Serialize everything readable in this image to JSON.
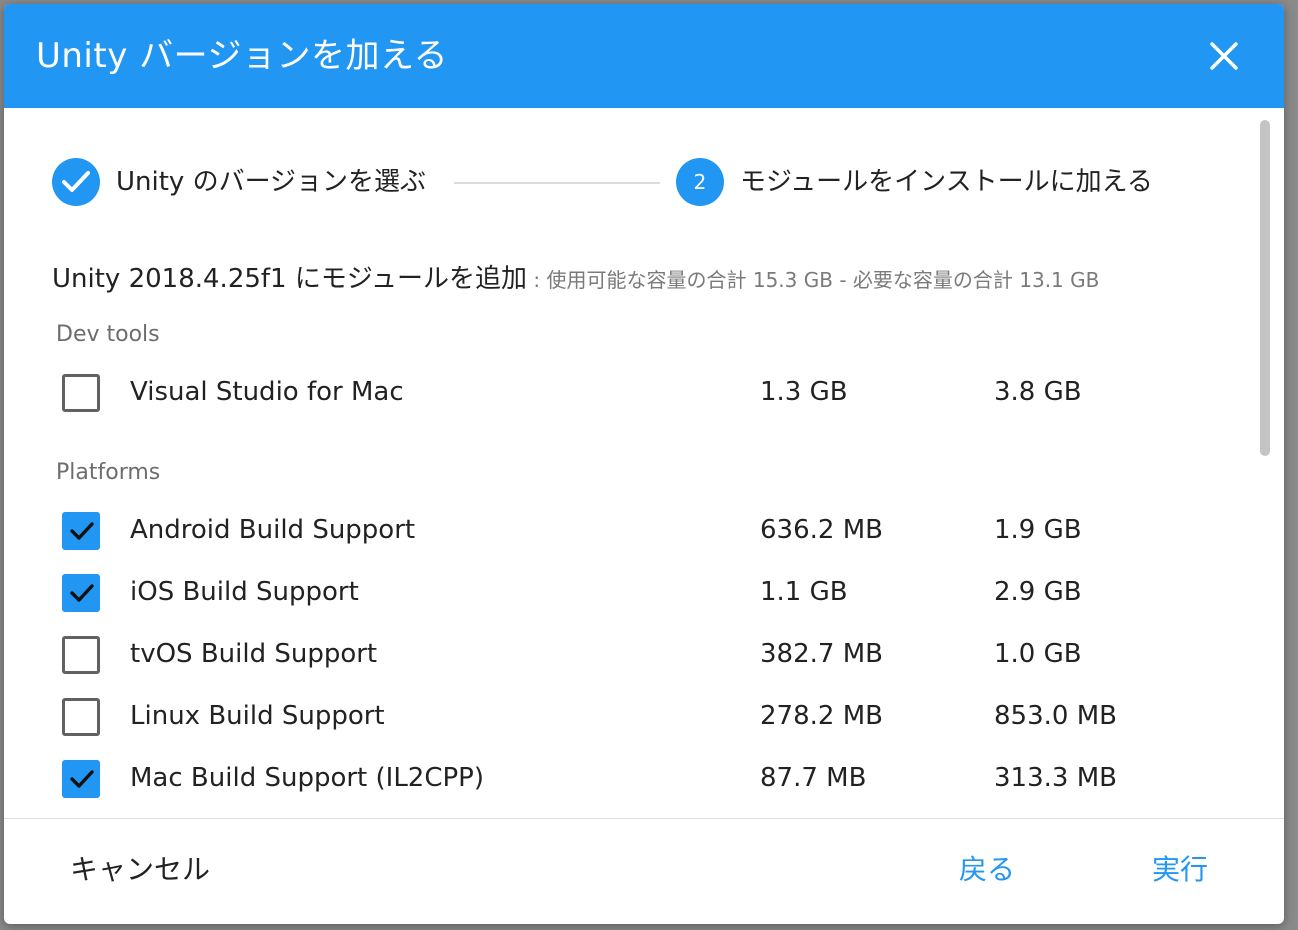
{
  "dialog": {
    "title": "Unity バージョンを加える",
    "close_icon": "close-icon"
  },
  "stepper": {
    "step1": {
      "label": "Unity のバージョンを選ぶ",
      "state": "completed",
      "icon": "check-icon"
    },
    "step2": {
      "number": "2",
      "label": "モジュールをインストールに加える",
      "state": "active"
    }
  },
  "summary": {
    "main": "Unity 2018.4.25f1 にモジュールを追加",
    "detail": " : 使用可能な容量の合計 15.3 GB - 必要な容量の合計 13.1 GB"
  },
  "sections": {
    "dev_tools": {
      "header": "Dev tools",
      "modules": [
        {
          "name": "Visual Studio for Mac",
          "download": "1.3 GB",
          "install": "3.8 GB",
          "checked": false
        }
      ]
    },
    "platforms": {
      "header": "Platforms",
      "modules": [
        {
          "name": "Android Build Support",
          "download": "636.2 MB",
          "install": "1.9 GB",
          "checked": true
        },
        {
          "name": "iOS Build Support",
          "download": "1.1 GB",
          "install": "2.9 GB",
          "checked": true
        },
        {
          "name": "tvOS Build Support",
          "download": "382.7 MB",
          "install": "1.0 GB",
          "checked": false
        },
        {
          "name": "Linux Build Support",
          "download": "278.2 MB",
          "install": "853.0 MB",
          "checked": false
        },
        {
          "name": "Mac Build Support (IL2CPP)",
          "download": "87.7 MB",
          "install": "313.3 MB",
          "checked": true
        }
      ]
    }
  },
  "footer": {
    "cancel_label": "キャンセル",
    "back_label": "戻る",
    "run_label": "実行"
  },
  "colors": {
    "accent": "#2196f3",
    "text": "#222222",
    "muted": "#7a7a7a"
  }
}
